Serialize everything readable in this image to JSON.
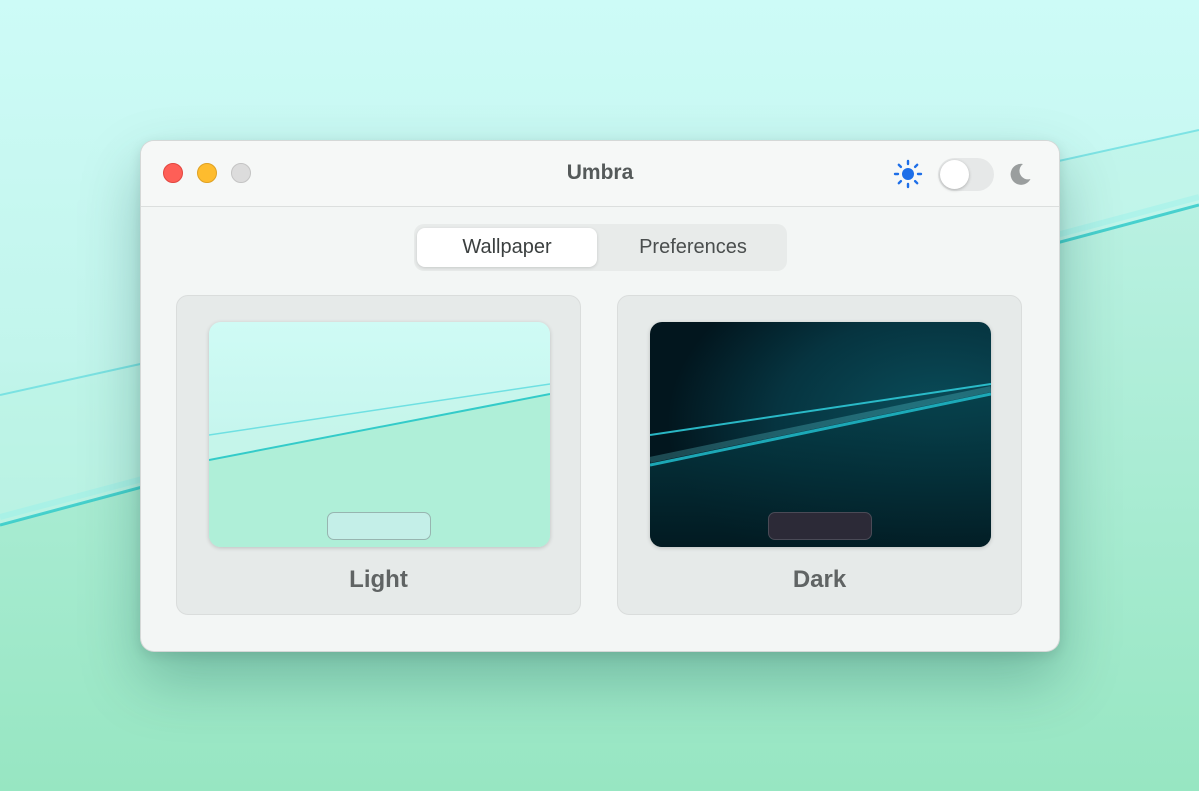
{
  "window": {
    "title": "Umbra"
  },
  "appearance_toggle": {
    "light_icon": "sun-icon",
    "dark_icon": "moon-icon",
    "state": "light"
  },
  "tabs": [
    {
      "label": "Wallpaper",
      "selected": true
    },
    {
      "label": "Preferences",
      "selected": false
    }
  ],
  "wallpapers": [
    {
      "label": "Light"
    },
    {
      "label": "Dark"
    }
  ],
  "colors": {
    "accent": "#1e6fe8",
    "close": "#fe5f57",
    "minimize": "#febc2e",
    "zoom_disabled": "#dcdcdc"
  }
}
